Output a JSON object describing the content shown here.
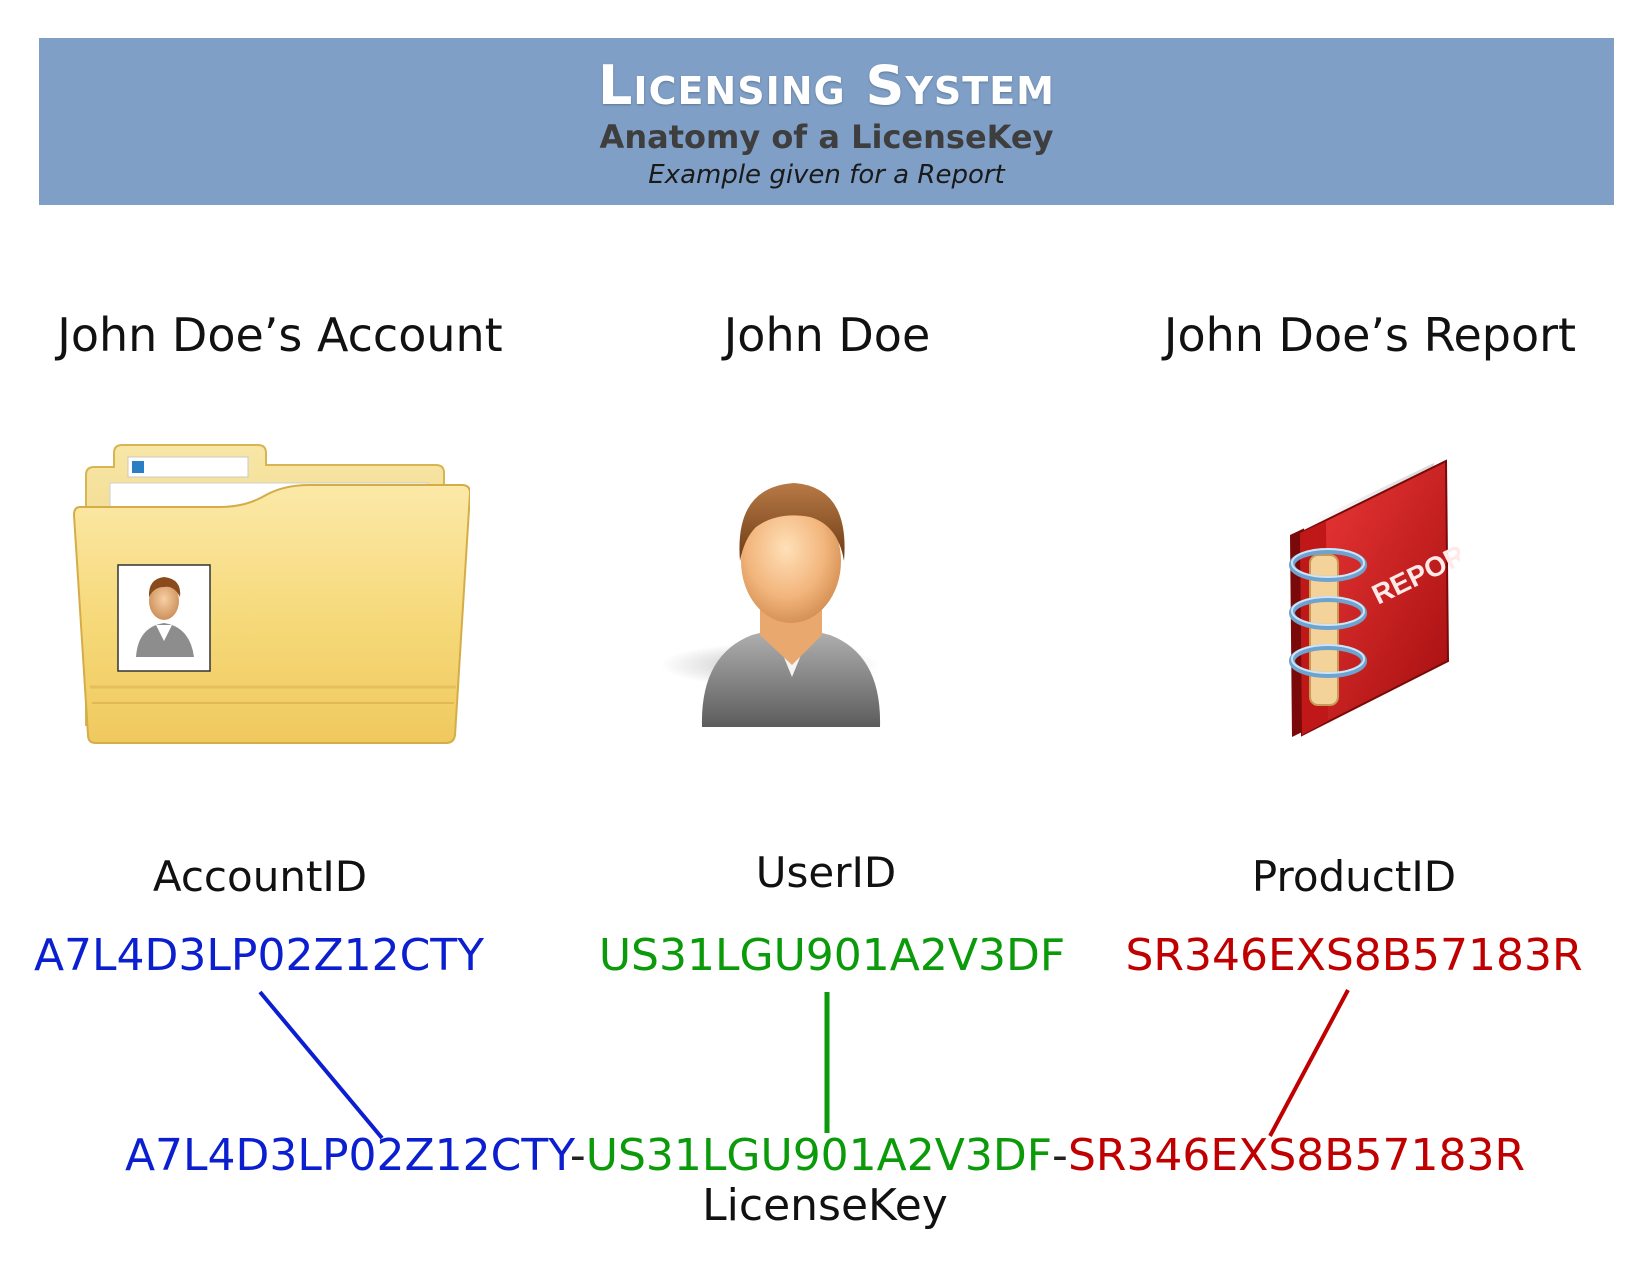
{
  "header": {
    "title": "Licensing System",
    "subtitle": "Anatomy of a LicenseKey",
    "note": "Example given for a Report"
  },
  "columns": [
    {
      "heading": "John Doe’s Account",
      "icon": "folder-with-user-icon",
      "id_label": "AccountID",
      "id_value": "A7L4D3LP02Z12CTY",
      "color": "#0b1fd0"
    },
    {
      "heading": "John Doe",
      "icon": "user-icon",
      "id_label": "UserID",
      "id_value": "US31LGU901A2V3DF",
      "color": "#0a9a0a"
    },
    {
      "heading": "John Doe’s Report",
      "icon": "report-binder-icon",
      "id_label": "ProductID",
      "id_value": "SR346EXS8B57183R",
      "color": "#c00000"
    }
  ],
  "license_key": {
    "part1": "A7L4D3LP02Z12CTY",
    "sep1": "-",
    "part2": "US31LGU901A2V3DF",
    "sep2": "-",
    "part3": "SR346EXS8B57183R",
    "caption": "LicenseKey"
  },
  "report_icon_text": "REPORT"
}
